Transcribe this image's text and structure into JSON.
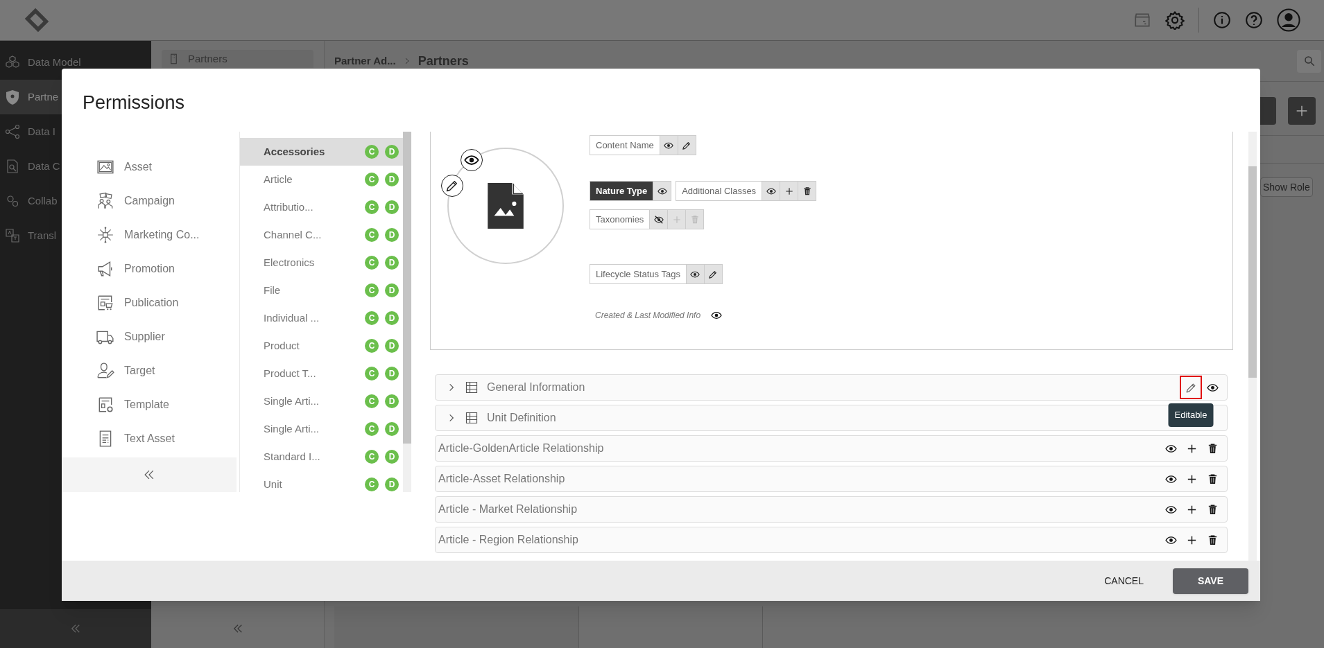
{
  "nav": {
    "items": [
      {
        "label": "Data Model",
        "selected": false
      },
      {
        "label": "Partne",
        "selected": true
      },
      {
        "label": "Data I",
        "selected": false
      },
      {
        "label": "Data C",
        "selected": false
      },
      {
        "label": "Collab",
        "selected": false
      },
      {
        "label": "Transl",
        "selected": false
      }
    ]
  },
  "panel": {
    "items": [
      "Partners"
    ]
  },
  "breadcrumb": [
    "Partner Ad...",
    "Partners"
  ],
  "toolbar": {
    "show_role": "Show Role"
  },
  "dialog": {
    "title": "Permissions",
    "categories": [
      {
        "label": "Asset",
        "selected": false
      },
      {
        "label": "Campaign",
        "selected": false
      },
      {
        "label": "Marketing Co...",
        "selected": false
      },
      {
        "label": "Promotion",
        "selected": false
      },
      {
        "label": "Publication",
        "selected": false
      },
      {
        "label": "Supplier",
        "selected": false
      },
      {
        "label": "Target",
        "selected": false
      },
      {
        "label": "Template",
        "selected": false
      },
      {
        "label": "Text Asset",
        "selected": false
      }
    ],
    "classes": [
      {
        "label": "Accessories",
        "selected": true,
        "badges": [
          "C",
          "D"
        ]
      },
      {
        "label": "Article",
        "selected": false,
        "badges": [
          "C",
          "D"
        ]
      },
      {
        "label": "Attributio...",
        "selected": false,
        "badges": [
          "C",
          "D"
        ]
      },
      {
        "label": "Channel C...",
        "selected": false,
        "badges": [
          "C",
          "D"
        ]
      },
      {
        "label": "Electronics",
        "selected": false,
        "badges": [
          "C",
          "D"
        ]
      },
      {
        "label": "File",
        "selected": false,
        "badges": [
          "C",
          "D"
        ]
      },
      {
        "label": "Individual ...",
        "selected": false,
        "badges": [
          "C",
          "D"
        ]
      },
      {
        "label": "Product",
        "selected": false,
        "badges": [
          "C",
          "D"
        ]
      },
      {
        "label": "Product T...",
        "selected": false,
        "badges": [
          "C",
          "D"
        ]
      },
      {
        "label": "Single Arti...",
        "selected": false,
        "badges": [
          "C",
          "D"
        ]
      },
      {
        "label": "Single Arti...",
        "selected": false,
        "badges": [
          "C",
          "D"
        ]
      },
      {
        "label": "Standard I...",
        "selected": false,
        "badges": [
          "C",
          "D"
        ]
      },
      {
        "label": "Unit",
        "selected": false,
        "badges": [
          "C",
          "D"
        ]
      }
    ],
    "field_rows": [
      [
        {
          "label": "Content Name",
          "kind": "plain",
          "actions": [
            {
              "kind": "view",
              "disabled": false
            },
            {
              "kind": "edit",
              "disabled": false
            }
          ]
        }
      ],
      [
        {
          "label": "Nature Type",
          "kind": "dark",
          "actions": [
            {
              "kind": "view",
              "disabled": false
            }
          ]
        },
        {
          "label": "Additional Classes",
          "kind": "plain",
          "actions": [
            {
              "kind": "view",
              "disabled": false
            },
            {
              "kind": "add",
              "disabled": false
            },
            {
              "kind": "delete",
              "disabled": false
            }
          ]
        }
      ],
      [
        {
          "label": "Taxonomies",
          "kind": "plain",
          "actions": [
            {
              "kind": "hidden",
              "disabled": false
            },
            {
              "kind": "add",
              "disabled": true
            },
            {
              "kind": "delete",
              "disabled": true
            }
          ]
        }
      ],
      [
        {
          "label": "Lifecycle Status Tags",
          "kind": "plain",
          "actions": [
            {
              "kind": "view",
              "disabled": false
            },
            {
              "kind": "edit",
              "disabled": false
            }
          ]
        }
      ],
      [
        {
          "label": "Created & Last Modified Info",
          "kind": "note",
          "actions": [
            {
              "kind": "view",
              "disabled": false
            }
          ]
        }
      ]
    ],
    "sections": [
      {
        "label": "General Information",
        "kind": "group",
        "actions": [
          {
            "kind": "edit",
            "highlighted": true
          },
          {
            "kind": "view",
            "highlighted": false
          }
        ]
      },
      {
        "label": "Unit Definition",
        "kind": "group"
      },
      {
        "label": "Article-GoldenArticle Relationship",
        "kind": "relationship",
        "actions": [
          {
            "kind": "view",
            "highlighted": false
          },
          {
            "kind": "add",
            "highlighted": false
          },
          {
            "kind": "delete",
            "highlighted": false
          }
        ]
      },
      {
        "label": "Article-Asset Relationship",
        "kind": "relationship",
        "actions": [
          {
            "kind": "view",
            "highlighted": false
          },
          {
            "kind": "add",
            "highlighted": false
          },
          {
            "kind": "delete",
            "highlighted": false
          }
        ]
      },
      {
        "label": "Article - Market Relationship",
        "kind": "relationship",
        "actions": [
          {
            "kind": "view",
            "highlighted": false
          },
          {
            "kind": "add",
            "highlighted": false
          },
          {
            "kind": "delete",
            "highlighted": false
          }
        ]
      },
      {
        "label": "Article - Region Relationship",
        "kind": "relationship",
        "actions": [
          {
            "kind": "view",
            "highlighted": false
          },
          {
            "kind": "add",
            "highlighted": false
          },
          {
            "kind": "delete",
            "highlighted": false
          }
        ]
      }
    ],
    "tooltip": "Editable",
    "cancel": "CANCEL",
    "save": "SAVE"
  }
}
